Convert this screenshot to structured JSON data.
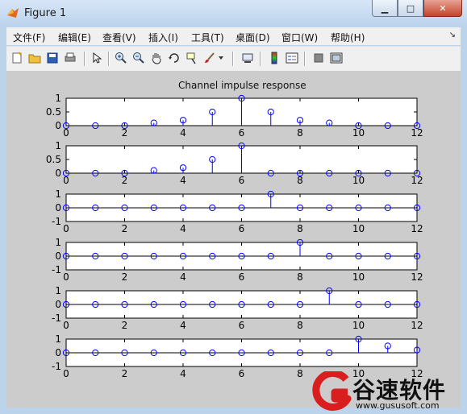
{
  "window": {
    "title": "Figure 1",
    "minimize_label": "▁",
    "maximize_label": "□",
    "close_label": "✕"
  },
  "menu": {
    "items": [
      "文件(F)",
      "编辑(E)",
      "查看(V)",
      "插入(I)",
      "工具(T)",
      "桌面(D)",
      "窗口(W)",
      "帮助(H)"
    ],
    "overflow_glyph": "↘"
  },
  "toolbar": {
    "icons": [
      "new-figure-icon",
      "open-file-icon",
      "save-icon",
      "print-icon",
      "edit-plot-arrow-icon",
      "zoom-in-icon",
      "zoom-out-icon",
      "pan-hand-icon",
      "rotate-3d-icon",
      "data-cursor-icon",
      "brush-icon",
      "link-plot-icon",
      "colorbar-icon",
      "legend-icon",
      "hide-plot-tools-icon",
      "show-plot-tools-icon"
    ]
  },
  "chart_data": {
    "type": "stem",
    "title": "Channel impulse response",
    "xlabel": "",
    "ylabel": "",
    "x": [
      0,
      1,
      2,
      3,
      4,
      5,
      6,
      7,
      8,
      9,
      10,
      11,
      12
    ],
    "xlim": [
      0,
      12
    ],
    "xticks": [
      "0",
      "2",
      "4",
      "6",
      "8",
      "10",
      "12"
    ],
    "marker_color": "#0000ff",
    "panels": [
      {
        "ylim": [
          0,
          1
        ],
        "yticks": [
          "1",
          "0.5",
          "0"
        ],
        "values": [
          0,
          0,
          0,
          0.1,
          0.2,
          0.5,
          1,
          0.5,
          0.2,
          0.1,
          0,
          0,
          0
        ]
      },
      {
        "ylim": [
          0,
          1
        ],
        "yticks": [
          "1",
          "0.5",
          "0"
        ],
        "values": [
          0,
          0,
          0,
          0.1,
          0.2,
          0.5,
          1,
          0,
          0,
          0,
          0,
          0,
          0
        ]
      },
      {
        "ylim": [
          -1,
          1
        ],
        "yticks": [
          "1",
          "0",
          "-1"
        ],
        "values": [
          0,
          0,
          0,
          0,
          0,
          0,
          0,
          1,
          0,
          0,
          0,
          0,
          0
        ]
      },
      {
        "ylim": [
          -1,
          1
        ],
        "yticks": [
          "1",
          "0",
          "-1"
        ],
        "values": [
          0,
          0,
          0,
          0,
          0,
          0,
          0,
          0,
          1,
          0,
          0,
          0,
          0
        ]
      },
      {
        "ylim": [
          -1,
          1
        ],
        "yticks": [
          "1",
          "0",
          "-1"
        ],
        "values": [
          0,
          0,
          0,
          0,
          0,
          0,
          0,
          0,
          0,
          1,
          0,
          0,
          0
        ]
      },
      {
        "ylim": [
          -1,
          1
        ],
        "yticks": [
          "1",
          "0",
          "-1"
        ],
        "values": [
          0,
          0,
          0,
          0,
          0,
          0,
          0,
          0,
          0,
          0,
          1,
          0.5,
          0.2
        ]
      }
    ]
  },
  "watermark": {
    "brand_cn": "谷速软件",
    "url": "www.gususoft.com",
    "logo_letter": "G"
  }
}
